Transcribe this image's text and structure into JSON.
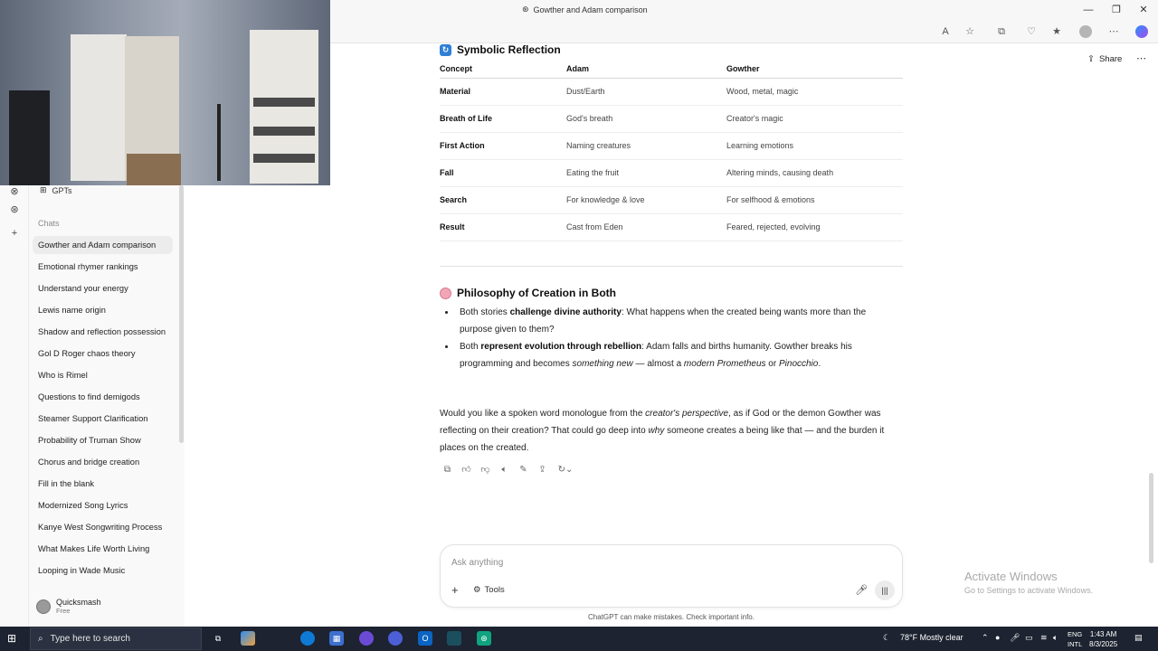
{
  "window": {
    "title": "Gowther and Adam comparison"
  },
  "header": {
    "share_label": "Share"
  },
  "sidebar": {
    "gpts_label": "GPTs",
    "chats_label": "Chats",
    "chats": [
      "Gowther and Adam comparison",
      "Emotional rhymer rankings",
      "Understand your energy",
      "Lewis name origin",
      "Shadow and reflection possession",
      "Gol D Roger chaos theory",
      "Who is Rimel",
      "Questions to find demigods",
      "Steamer Support Clarification",
      "Probability of Truman Show",
      "Chorus and bridge creation",
      "Fill in the blank",
      "Modernized Song Lyrics",
      "Kanye West Songwriting Process",
      "What Makes Life Worth Living",
      "Looping in Wade Music"
    ],
    "user": {
      "name": "Quicksmash",
      "plan": "Free"
    }
  },
  "section1": {
    "title": "Symbolic Reflection",
    "headers": [
      "Concept",
      "Adam",
      "Gowther"
    ],
    "rows": [
      [
        "Material",
        "Dust/Earth",
        "Wood, metal, magic"
      ],
      [
        "Breath of Life",
        "God's breath",
        "Creator's magic"
      ],
      [
        "First Action",
        "Naming creatures",
        "Learning emotions"
      ],
      [
        "Fall",
        "Eating the fruit",
        "Altering minds, causing death"
      ],
      [
        "Search",
        "For knowledge & love",
        "For selfhood & emotions"
      ],
      [
        "Result",
        "Cast from Eden",
        "Feared, rejected, evolving"
      ]
    ]
  },
  "section2": {
    "title": "Philosophy of Creation in Both",
    "b1_pre": "Both stories ",
    "b1_bold": "challenge divine authority",
    "b1_post": ": What happens when the created being wants more than the purpose given to them?",
    "b2_pre": "Both ",
    "b2_bold": "represent evolution through rebellion",
    "b2_mid": ": Adam falls and births humanity. Gowther breaks his programming and becomes ",
    "b2_em1": "something new",
    "b2_mid2": " — almost a ",
    "b2_em2": "modern Prometheus",
    "b2_or": " or ",
    "b2_em3": "Pinocchio",
    "b2_end": "."
  },
  "closing": {
    "p1": "Would you like a spoken word monologue from the ",
    "em1": "creator's perspective",
    "p2": ", as if God or the demon Gowther was reflecting on their creation? That could go deep into ",
    "em2": "why",
    "p3": " someone creates a being like that — and the burden it places on the created."
  },
  "composer": {
    "placeholder": "Ask anything",
    "tools_label": "Tools",
    "disclaimer": "ChatGPT can make mistakes. Check important info."
  },
  "watermark": {
    "line1": "Activate Windows",
    "line2": "Go to Settings to activate Windows."
  },
  "taskbar": {
    "search_placeholder": "Type here to search",
    "weather": "78°F  Mostly clear",
    "lang1": "ENG",
    "lang2": "INTL",
    "time": "1:43 AM",
    "date": "8/3/2025"
  }
}
